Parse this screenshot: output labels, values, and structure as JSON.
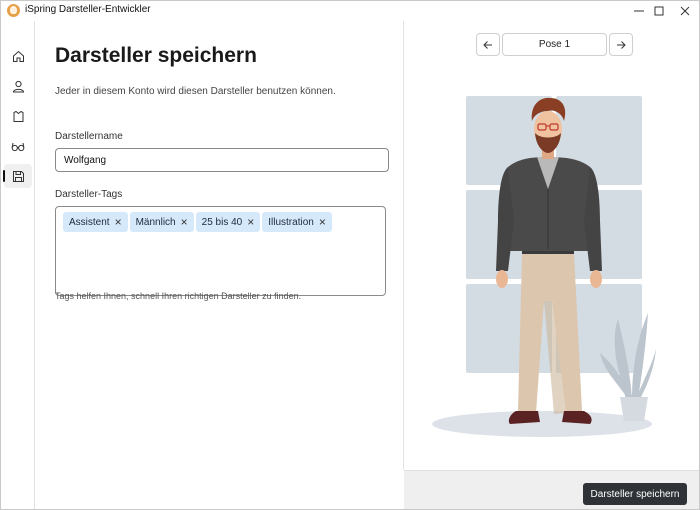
{
  "window": {
    "title": "iSpring Darsteller-Entwickler"
  },
  "sidebar": {
    "items": [
      {
        "name": "home-icon",
        "active": false
      },
      {
        "name": "person-icon",
        "active": false
      },
      {
        "name": "shirt-icon",
        "active": false
      },
      {
        "name": "glasses-icon",
        "active": false
      },
      {
        "name": "save-icon",
        "active": true
      }
    ]
  },
  "main": {
    "title": "Darsteller speichern",
    "subtitle": "Jeder in diesem Konto wird diesen Darsteller benutzen können.",
    "name_label": "Darstellername",
    "name_value": "Wolfgang",
    "tags_label": "Darsteller-Tags",
    "tags": [
      "Assistent",
      "Männlich",
      "25 bis 40",
      "Illustration"
    ],
    "tags_help": "Tags helfen Ihnen, schnell Ihren richtigen Darsteller zu finden."
  },
  "preview": {
    "pose_label": "Pose 1"
  },
  "footer": {
    "save_label": "Darsteller speichern"
  },
  "colors": {
    "accent_dark": "#2f3338",
    "tag_bg": "#d6e9fb",
    "window_bg": "#d3dbe3"
  }
}
